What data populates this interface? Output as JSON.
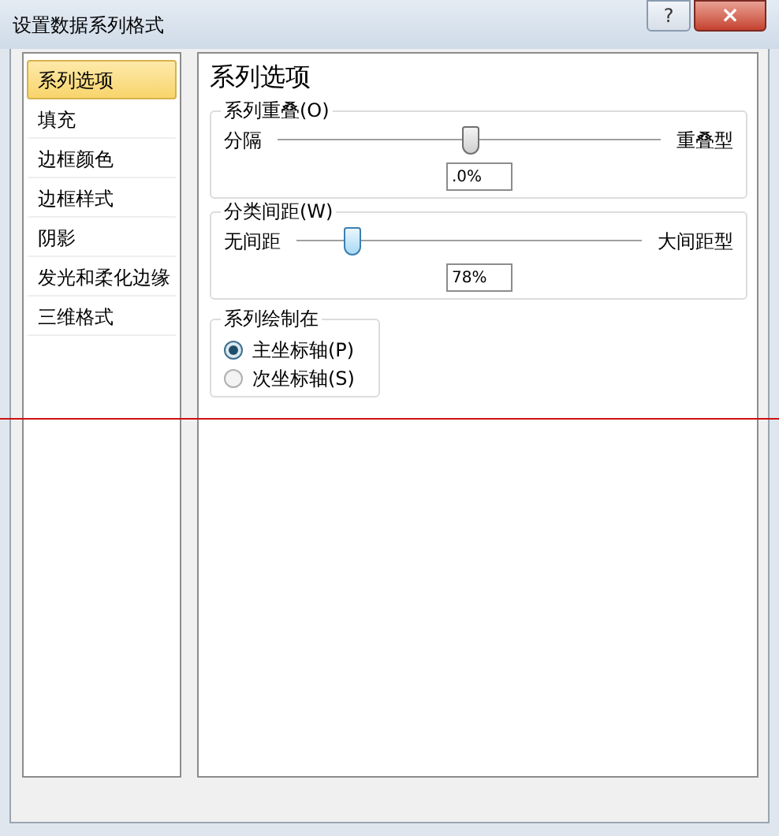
{
  "window": {
    "title": "设置数据系列格式",
    "buttons": [
      {
        "kind": "help",
        "label": "?"
      },
      {
        "kind": "close",
        "label": "×"
      }
    ]
  },
  "sidebar": {
    "items": [
      {
        "label": "系列选项",
        "selected": true
      },
      {
        "label": "填充",
        "selected": false
      },
      {
        "label": "边框颜色",
        "selected": false
      },
      {
        "label": "边框样式",
        "selected": false
      },
      {
        "label": "阴影",
        "selected": false
      },
      {
        "label": "发光和柔化边缘",
        "selected": false
      },
      {
        "label": "三维格式",
        "selected": false
      }
    ]
  },
  "panel": {
    "title": "系列选项",
    "sliders": [
      {
        "group": "系列重叠(O)",
        "min_label": "分隔",
        "max_label": "重叠型",
        "level": 0.5,
        "value": ".0%"
      },
      {
        "group": "分类间距(W)",
        "min_label": "无间距",
        "max_label": "大间距型",
        "level": 0.16,
        "value": "78%"
      }
    ],
    "plot_on": {
      "group": "系列绘制在",
      "options": [
        {
          "label": "主坐标轴(P)",
          "selected": true
        },
        {
          "label": "次坐标轴(S)",
          "selected": false
        }
      ]
    }
  }
}
